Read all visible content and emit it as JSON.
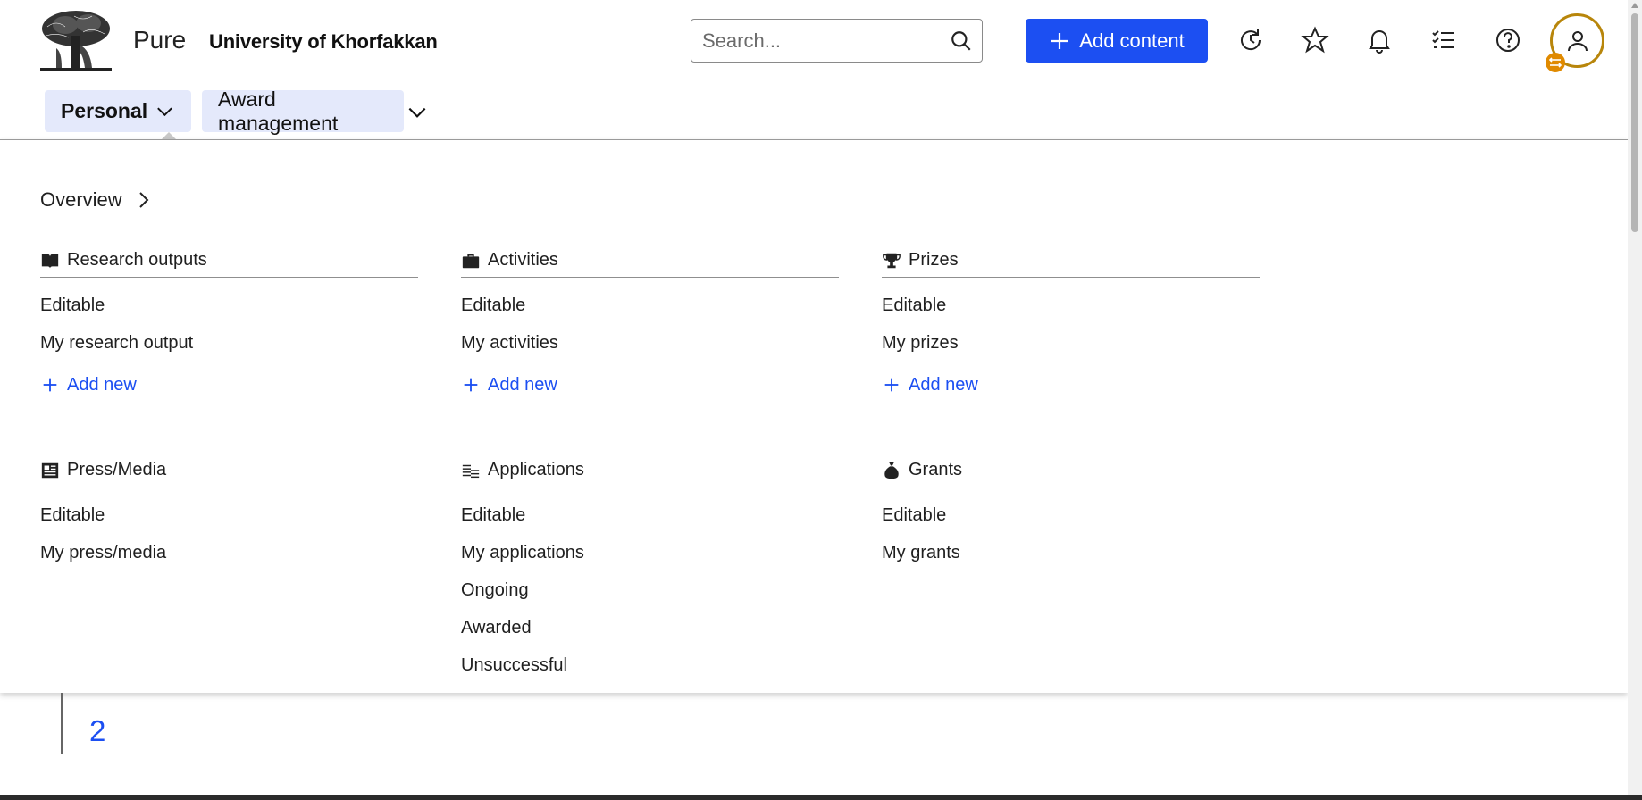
{
  "header": {
    "brand": "Pure",
    "organization": "University of Khorfakkan",
    "search_placeholder": "Search...",
    "add_content_label": "Add content",
    "icons": [
      "history-icon",
      "star-icon",
      "bell-icon",
      "tasks-icon",
      "help-icon"
    ]
  },
  "nav": {
    "personal_label": "Personal",
    "award_label": "Award management"
  },
  "menu": {
    "overview_label": "Overview",
    "sections": [
      {
        "title": "Research outputs",
        "icon": "book-icon",
        "links": [
          "Editable",
          "My research output"
        ],
        "add_new": "Add new"
      },
      {
        "title": "Activities",
        "icon": "briefcase-icon",
        "links": [
          "Editable",
          "My activities"
        ],
        "add_new": "Add new"
      },
      {
        "title": "Prizes",
        "icon": "trophy-icon",
        "links": [
          "Editable",
          "My prizes"
        ],
        "add_new": "Add new"
      },
      {
        "title": "Press/Media",
        "icon": "newspaper-icon",
        "links": [
          "Editable",
          "My press/media"
        ]
      },
      {
        "title": "Applications",
        "icon": "coins-icon",
        "links": [
          "Editable",
          "My applications",
          "Ongoing",
          "Awarded",
          "Unsuccessful"
        ]
      },
      {
        "title": "Grants",
        "icon": "money-bag-icon",
        "links": [
          "Editable",
          "My grants"
        ]
      }
    ]
  },
  "content": {
    "page_number": "2"
  },
  "colors": {
    "accent": "#1c4ff2",
    "nav_bg": "#e4e9fb",
    "avatar_ring": "#b8860b"
  }
}
